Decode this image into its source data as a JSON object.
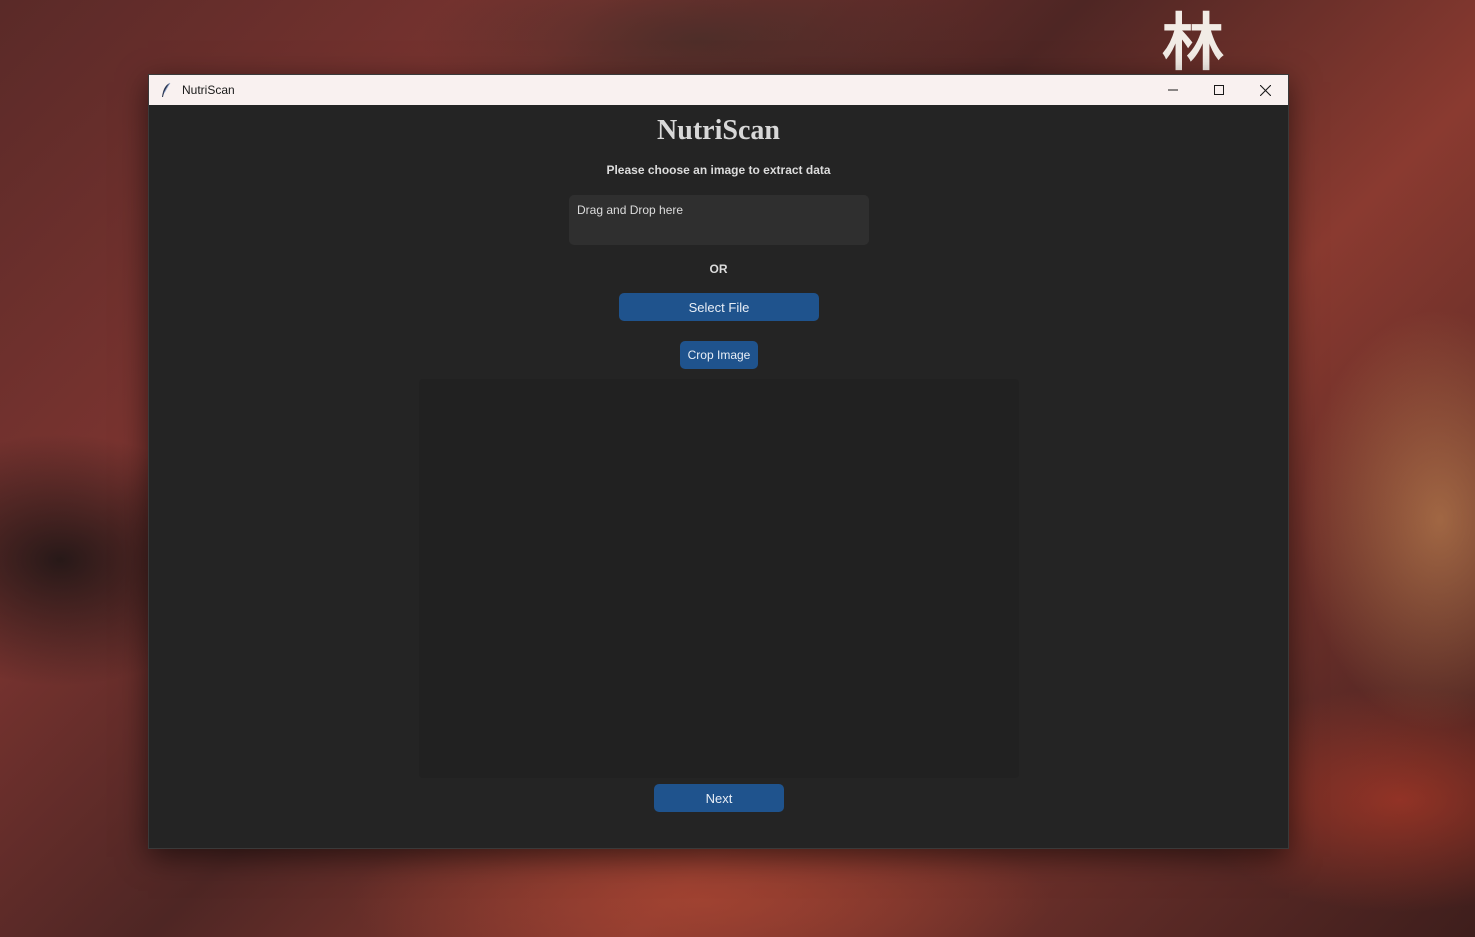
{
  "window": {
    "title": "NutriScan"
  },
  "main": {
    "heading": "NutriScan",
    "instruction": "Please choose an image to extract data",
    "drop_zone_text": "Drag and Drop here",
    "or_label": "OR",
    "select_file_label": "Select File",
    "crop_image_label": "Crop Image",
    "next_label": "Next"
  },
  "colors": {
    "accent": "#1f538d",
    "background": "#242424",
    "titlebar": "#f9f1f0"
  },
  "icons": {
    "app": "feather-icon",
    "minimize": "minimize-icon",
    "maximize": "maximize-icon",
    "close": "close-icon"
  }
}
